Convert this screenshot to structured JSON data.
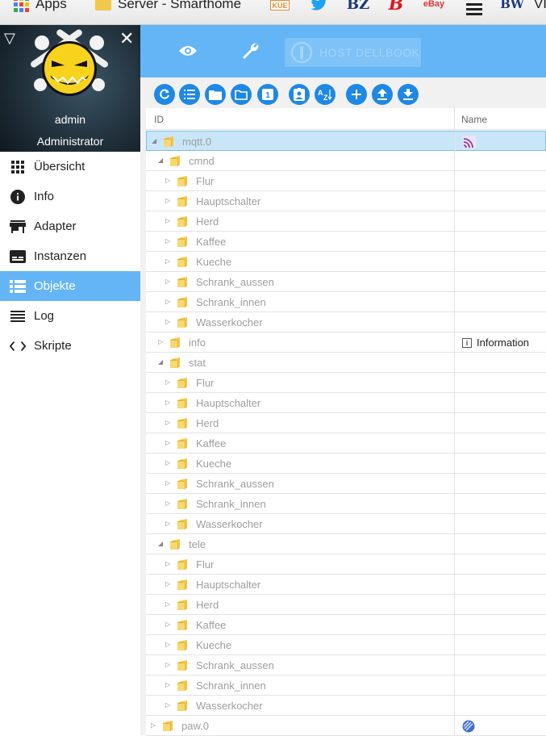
{
  "browser": {
    "bookmarks": {
      "apps": "Apps",
      "server": "Server - Smarthome",
      "kue_icon": "KÜE",
      "bz_icon": "BZ",
      "b_icon": "B",
      "ebay_icon": "eBay",
      "bw_icon": "BW",
      "last": "VI"
    }
  },
  "sidebar": {
    "user_name": "admin",
    "user_role": "Administrator",
    "items": [
      {
        "label": "Übersicht",
        "icon": "grid-icon"
      },
      {
        "label": "Info",
        "icon": "info-icon"
      },
      {
        "label": "Adapter",
        "icon": "store-icon"
      },
      {
        "label": "Instanzen",
        "icon": "instances-icon"
      },
      {
        "label": "Objekte",
        "icon": "list-icon",
        "active": true
      },
      {
        "label": "Log",
        "icon": "log-icon"
      },
      {
        "label": "Skripte",
        "icon": "code-icon"
      }
    ]
  },
  "appbar": {
    "host_label": "HOST DELLBOOK"
  },
  "table": {
    "col_id": "ID",
    "col_name": "Name",
    "rows": [
      {
        "label": "mqtt.0",
        "level": 0,
        "expanded": true,
        "selected": true,
        "name": ""
      },
      {
        "label": "cmnd",
        "level": 1,
        "expanded": true,
        "name": ""
      },
      {
        "label": "Flur",
        "level": 2,
        "name": ""
      },
      {
        "label": "Hauptschalter",
        "level": 2,
        "name": ""
      },
      {
        "label": "Herd",
        "level": 2,
        "name": ""
      },
      {
        "label": "Kaffee",
        "level": 2,
        "name": ""
      },
      {
        "label": "Kueche",
        "level": 2,
        "name": ""
      },
      {
        "label": "Schrank_aussen",
        "level": 2,
        "name": ""
      },
      {
        "label": "Schrank_innen",
        "level": 2,
        "name": ""
      },
      {
        "label": "Wasserkocher",
        "level": 2,
        "name": ""
      },
      {
        "label": "info",
        "level": 1,
        "name": "Information"
      },
      {
        "label": "stat",
        "level": 1,
        "expanded": true,
        "name": ""
      },
      {
        "label": "Flur",
        "level": 2,
        "name": ""
      },
      {
        "label": "Hauptschalter",
        "level": 2,
        "name": ""
      },
      {
        "label": "Herd",
        "level": 2,
        "name": ""
      },
      {
        "label": "Kaffee",
        "level": 2,
        "name": ""
      },
      {
        "label": "Kueche",
        "level": 2,
        "name": ""
      },
      {
        "label": "Schrank_aussen",
        "level": 2,
        "name": ""
      },
      {
        "label": "Schrank_innen",
        "level": 2,
        "name": ""
      },
      {
        "label": "Wasserkocher",
        "level": 2,
        "name": ""
      },
      {
        "label": "tele",
        "level": 1,
        "expanded": true,
        "name": ""
      },
      {
        "label": "Flur",
        "level": 2,
        "name": ""
      },
      {
        "label": "Hauptschalter",
        "level": 2,
        "name": ""
      },
      {
        "label": "Herd",
        "level": 2,
        "name": ""
      },
      {
        "label": "Kaffee",
        "level": 2,
        "name": ""
      },
      {
        "label": "Kueche",
        "level": 2,
        "name": ""
      },
      {
        "label": "Schrank_aussen",
        "level": 2,
        "name": ""
      },
      {
        "label": "Schrank_innen",
        "level": 2,
        "name": ""
      },
      {
        "label": "Wasserkocher",
        "level": 2,
        "name": ""
      },
      {
        "label": "paw.0",
        "level": 0,
        "name": ""
      }
    ]
  },
  "colors": {
    "accent": "#64b5f6",
    "toolbar_button": "#1e88e5",
    "folder": "#f2c84b",
    "selected_row": "#c8e6f8"
  }
}
